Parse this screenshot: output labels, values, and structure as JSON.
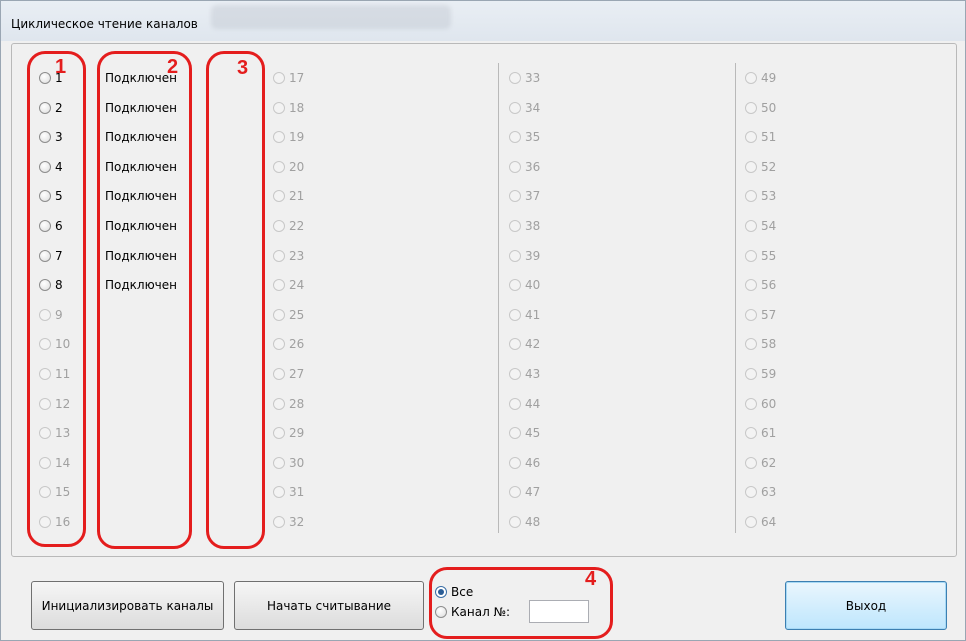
{
  "window": {
    "title": "Циклическое чтение каналов"
  },
  "channels": {
    "col1": [
      {
        "label": "1",
        "enabled": true
      },
      {
        "label": "2",
        "enabled": true
      },
      {
        "label": "3",
        "enabled": true
      },
      {
        "label": "4",
        "enabled": true
      },
      {
        "label": "5",
        "enabled": true
      },
      {
        "label": "6",
        "enabled": true
      },
      {
        "label": "7",
        "enabled": true
      },
      {
        "label": "8",
        "enabled": true
      },
      {
        "label": "9",
        "enabled": false
      },
      {
        "label": "10",
        "enabled": false
      },
      {
        "label": "11",
        "enabled": false
      },
      {
        "label": "12",
        "enabled": false
      },
      {
        "label": "13",
        "enabled": false
      },
      {
        "label": "14",
        "enabled": false
      },
      {
        "label": "15",
        "enabled": false
      },
      {
        "label": "16",
        "enabled": false
      }
    ],
    "col2": [
      "17",
      "18",
      "19",
      "20",
      "21",
      "22",
      "23",
      "24",
      "25",
      "26",
      "27",
      "28",
      "29",
      "30",
      "31",
      "32"
    ],
    "col3": [
      "33",
      "34",
      "35",
      "36",
      "37",
      "38",
      "39",
      "40",
      "41",
      "42",
      "43",
      "44",
      "45",
      "46",
      "47",
      "48"
    ],
    "col4": [
      "49",
      "50",
      "51",
      "52",
      "53",
      "54",
      "55",
      "56",
      "57",
      "58",
      "59",
      "60",
      "61",
      "62",
      "63",
      "64"
    ]
  },
  "statuses": [
    "Подключен",
    "Подключен",
    "Подключен",
    "Подключен",
    "Подключен",
    "Подключен",
    "Подключен",
    "Подключен"
  ],
  "annotations": [
    "1",
    "2",
    "3",
    "4"
  ],
  "buttons": {
    "init": "Инициализировать каналы",
    "start": "Начать считывание",
    "exit": "Выход"
  },
  "mode": {
    "all": "Все",
    "channel": "Канал №:",
    "selected": "all",
    "channel_value": ""
  },
  "colors": {
    "annotation": "#e41d1d"
  }
}
